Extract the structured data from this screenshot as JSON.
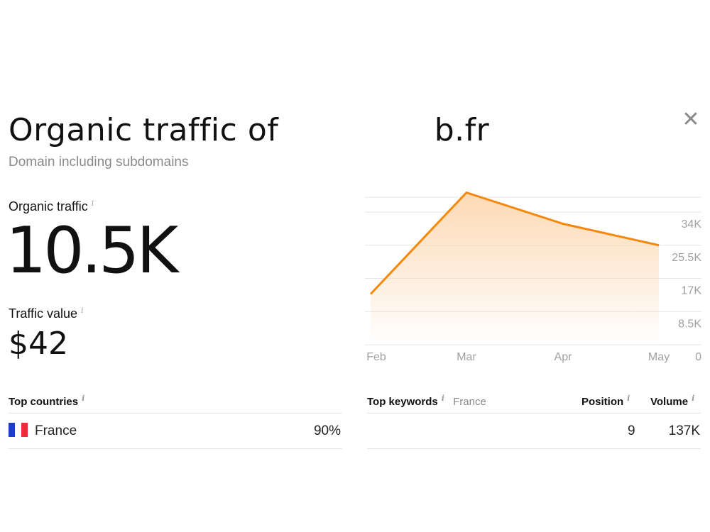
{
  "header": {
    "title_prefix": "Organic traffic of",
    "title_suffix": "b.fr",
    "subtitle": "Domain including subdomains",
    "close_symbol": "✕"
  },
  "metrics": {
    "organic_traffic_label": "Organic traffic",
    "organic_traffic_value": "10.5K",
    "traffic_value_label": "Traffic value",
    "traffic_value_value": "$42",
    "info_symbol": "i"
  },
  "chart_data": {
    "type": "area",
    "categories": [
      "Feb",
      "Mar",
      "Apr",
      "May"
    ],
    "values": [
      13000,
      39000,
      31000,
      25500
    ],
    "y_ticks": [
      "0",
      "8.5K",
      "17K",
      "25.5K",
      "34K"
    ],
    "y_tick_values": [
      0,
      8500,
      17000,
      25500,
      34000
    ],
    "ylim": [
      0,
      40000
    ],
    "grid": true,
    "line_color": "#f5880a",
    "fill_color": "#fcd7b0"
  },
  "top_countries": {
    "header": "Top countries",
    "rows": [
      {
        "country": "France",
        "share": "90%"
      }
    ]
  },
  "top_keywords": {
    "header": "Top keywords",
    "filter": "France",
    "position_header": "Position",
    "volume_header": "Volume",
    "rows": [
      {
        "position": "9",
        "volume": "137K"
      }
    ]
  }
}
